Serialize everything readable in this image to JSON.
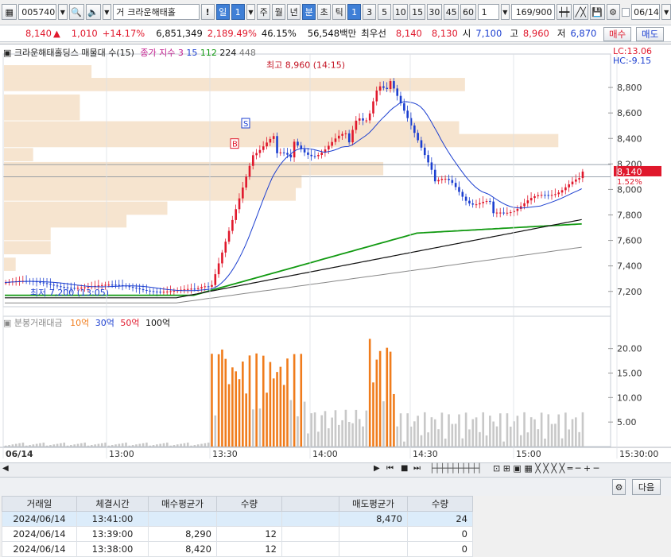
{
  "toolbar": {
    "code": "005740",
    "name_prefix": "거",
    "name": "크라운해태홀",
    "warn": "!",
    "period_buttons": [
      "일",
      "주",
      "월",
      "년",
      "분",
      "초",
      "틱"
    ],
    "day_count": "1",
    "min_buttons": [
      "1",
      "3",
      "5",
      "10",
      "15",
      "30",
      "45",
      "60"
    ],
    "interval_value": "1",
    "count_text": "169/900",
    "date_value": "06/14"
  },
  "quote": {
    "price": "8,140",
    "change_arrow": "▲",
    "change": "1,010",
    "change_pct": "+14.17%",
    "volume": "6,851,349",
    "volume_ratio": "2,189.49%",
    "turnover_pct": "46.15%",
    "amount": "56,548백만",
    "priority_label": "최우선",
    "ask": "8,140",
    "bid": "8,130",
    "open_label": "시",
    "open": "7,100",
    "high_label": "고",
    "high": "8,960",
    "low_label": "저",
    "low": "6,870",
    "buy_label": "매수",
    "sell_label": "매도"
  },
  "price_panel": {
    "title": "크라운해태홀딩스 매물대 수(15)",
    "ma_label": "종가 지수",
    "ma_values": [
      "3",
      "15",
      "112",
      "224",
      "448"
    ],
    "lc_label": "LC:13.06",
    "hc_label": "HC:-9.15",
    "high_annotation": "최고 8,960 (14:15)",
    "low_annotation": "최저 7,200 (13:05)",
    "current_price_tag": "8,140",
    "current_pct_tag": "1.52%",
    "b_marker": "B",
    "s_marker": "S",
    "y_ticks": [
      "8,800",
      "8,600",
      "8,400",
      "8,200",
      "8,000",
      "7,800",
      "7,600",
      "7,400",
      "7,200"
    ]
  },
  "volume_panel": {
    "title": "분봉거래대금",
    "legend": [
      "10억",
      "30억",
      "50억",
      "100억"
    ],
    "y_ticks": [
      "20.00",
      "15.00",
      "10.00",
      "5.00"
    ]
  },
  "time_axis": [
    "06/14",
    "13:00",
    "13:30",
    "14:00",
    "14:30",
    "15:00",
    "15:30:00"
  ],
  "bottom": {
    "next_label": "다음"
  },
  "table": {
    "headers": [
      "거래일",
      "체결시간",
      "매수평균가",
      "수량",
      "",
      "매도평균가",
      "수량"
    ],
    "rows": [
      [
        "2024/06/14",
        "13:41:00",
        "",
        "",
        "",
        "8,470",
        "24"
      ],
      [
        "2024/06/14",
        "13:39:00",
        "8,290",
        "12",
        "",
        "",
        "0"
      ],
      [
        "2024/06/14",
        "13:38:00",
        "8,420",
        "12",
        "",
        "",
        "0"
      ]
    ]
  },
  "colors": {
    "up": "#e0182c",
    "down": "#1c3fd0",
    "ma112": "#129a12",
    "volume_orange": "#f07c1c",
    "profile": "#f6e4cf"
  }
}
